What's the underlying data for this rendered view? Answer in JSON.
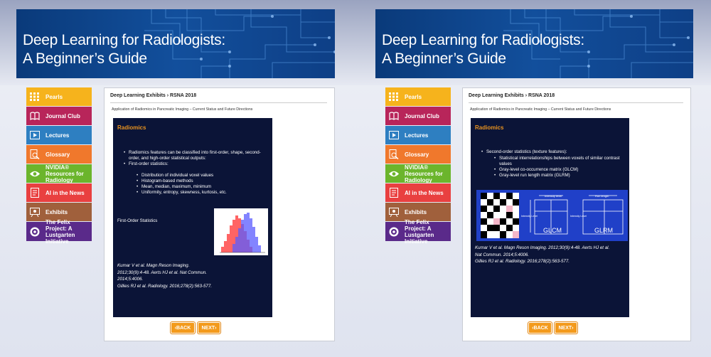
{
  "banner": {
    "line1": "Deep Learning for Radiologists:",
    "line2": "A Beginner’s Guide"
  },
  "nav": [
    {
      "label": "Pearls",
      "icon": "grid-icon",
      "color": "#f6b31c"
    },
    {
      "label": "Journal Club",
      "icon": "book-icon",
      "color": "#b8255a"
    },
    {
      "label": "Lectures",
      "icon": "play-icon",
      "color": "#2e7fc1"
    },
    {
      "label": "Glossary",
      "icon": "magnifier-doc-icon",
      "color": "#f0782c"
    },
    {
      "label": "NVIDIA® Resources for Radiology",
      "icon": "nvidia-eye-icon",
      "color": "#6bb52c"
    },
    {
      "label": "AI in the News",
      "icon": "newspaper-icon",
      "color": "#e94040"
    },
    {
      "label": "Exhibits",
      "icon": "easel-icon",
      "color": "#a0603c"
    },
    {
      "label": "The Felix Project: A Lustgarten Initiative",
      "icon": "felix-logo-icon",
      "color": "#5a2a8a"
    }
  ],
  "breadcrumb": "Deep Learning Exhibits › RSNA 2018",
  "subtitle": "Application of Radiomics in Pancreatic Imaging – Current Status and Future Directions",
  "left_slide": {
    "title": "Radiomics",
    "bullet1": "Radiomics features can be classified into first-order, shape, second-order, and high-order statistical outputs:",
    "bullet2": "First-order statistics:",
    "sub": [
      "Distribution of individual voxel values",
      "Histogram-based methods",
      "Mean, median, maximum, minimum",
      "Uniformity, entropy, skewness, kurtosis, etc."
    ],
    "chart_label": "First-Order Statistics",
    "refs": [
      "Kumar V et al. Magn Reson Imaging.",
      "2012;30(9):4-48. Aerts HJ et al. Nat Commun.",
      "2014;5:4006.",
      "Gillies RJ et al. Radiology. 2016;278(2):563-577."
    ]
  },
  "right_slide": {
    "title": "Radiomics",
    "bullet1": "Second-order statistics (texture features):",
    "sub": [
      "Statistical interrelationships between voxels of similar contrast values",
      "Gray-level co-occurrence matrix (GLCM)",
      "Gray-level run length matrix (GLRM)"
    ],
    "fig": {
      "intensity_level": "Intensity level",
      "intensity": "Intensity Level",
      "run_length": "Run length",
      "glcm": "GLCM",
      "glrm": "GLRM"
    },
    "refs": [
      "Kumar V et al. Magn Reson Imaging. 2012;30(9):4-48. Aerts HJ et al.",
      "Nat Commun. 2014;5:4006.",
      "Gillies RJ et al. Radiology. 2016;278(2):563-577."
    ]
  },
  "buttons": {
    "back": "BACK",
    "next": "NEXT"
  },
  "colors": {
    "banner": "#0e3f86",
    "slide_bg": "#0b1437",
    "accent": "#e8921f",
    "button": "#f39a1c"
  }
}
